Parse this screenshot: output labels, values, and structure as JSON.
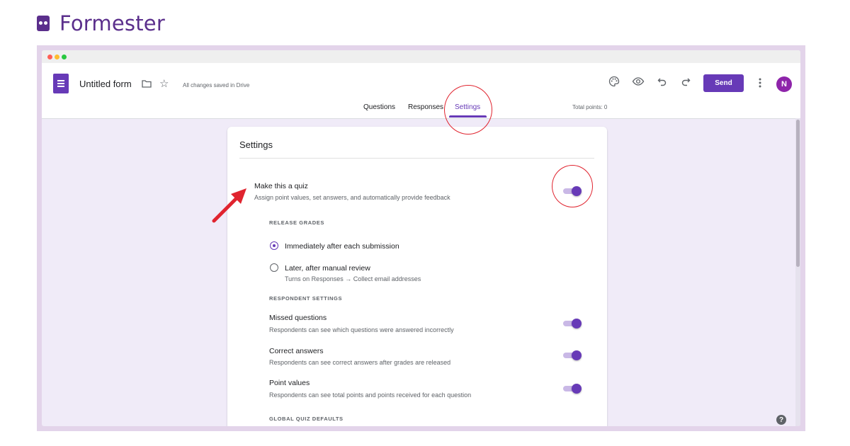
{
  "brand": {
    "name": "Formester"
  },
  "header": {
    "title": "Untitled form",
    "saved_status": "All changes saved in Drive",
    "send_label": "Send",
    "avatar_initial": "N"
  },
  "tabs": [
    {
      "label": "Questions"
    },
    {
      "label": "Responses"
    },
    {
      "label": "Settings"
    }
  ],
  "total_points": "Total points: 0",
  "settings": {
    "title": "Settings",
    "quiz": {
      "label": "Make this a quiz",
      "description": "Assign point values, set answers, and automatically provide feedback",
      "enabled": true
    },
    "release_grades": {
      "heading": "RELEASE GRADES",
      "options": [
        {
          "label": "Immediately after each submission",
          "selected": true
        },
        {
          "label": "Later, after manual review",
          "sublabel": "Turns on Responses → Collect email addresses",
          "selected": false
        }
      ]
    },
    "respondent_settings": {
      "heading": "RESPONDENT SETTINGS",
      "items": [
        {
          "label": "Missed questions",
          "description": "Respondents can see which questions were answered incorrectly",
          "enabled": true
        },
        {
          "label": "Correct answers",
          "description": "Respondents can see correct answers after grades are released",
          "enabled": true
        },
        {
          "label": "Point values",
          "description": "Respondents can see total points and points received for each question",
          "enabled": true
        }
      ]
    },
    "global_defaults": {
      "heading": "GLOBAL QUIZ DEFAULTS"
    }
  },
  "colors": {
    "accent": "#673ab7",
    "brand": "#5b2f8c",
    "annotation": "#e0242f",
    "background": "#f0ebf8"
  }
}
